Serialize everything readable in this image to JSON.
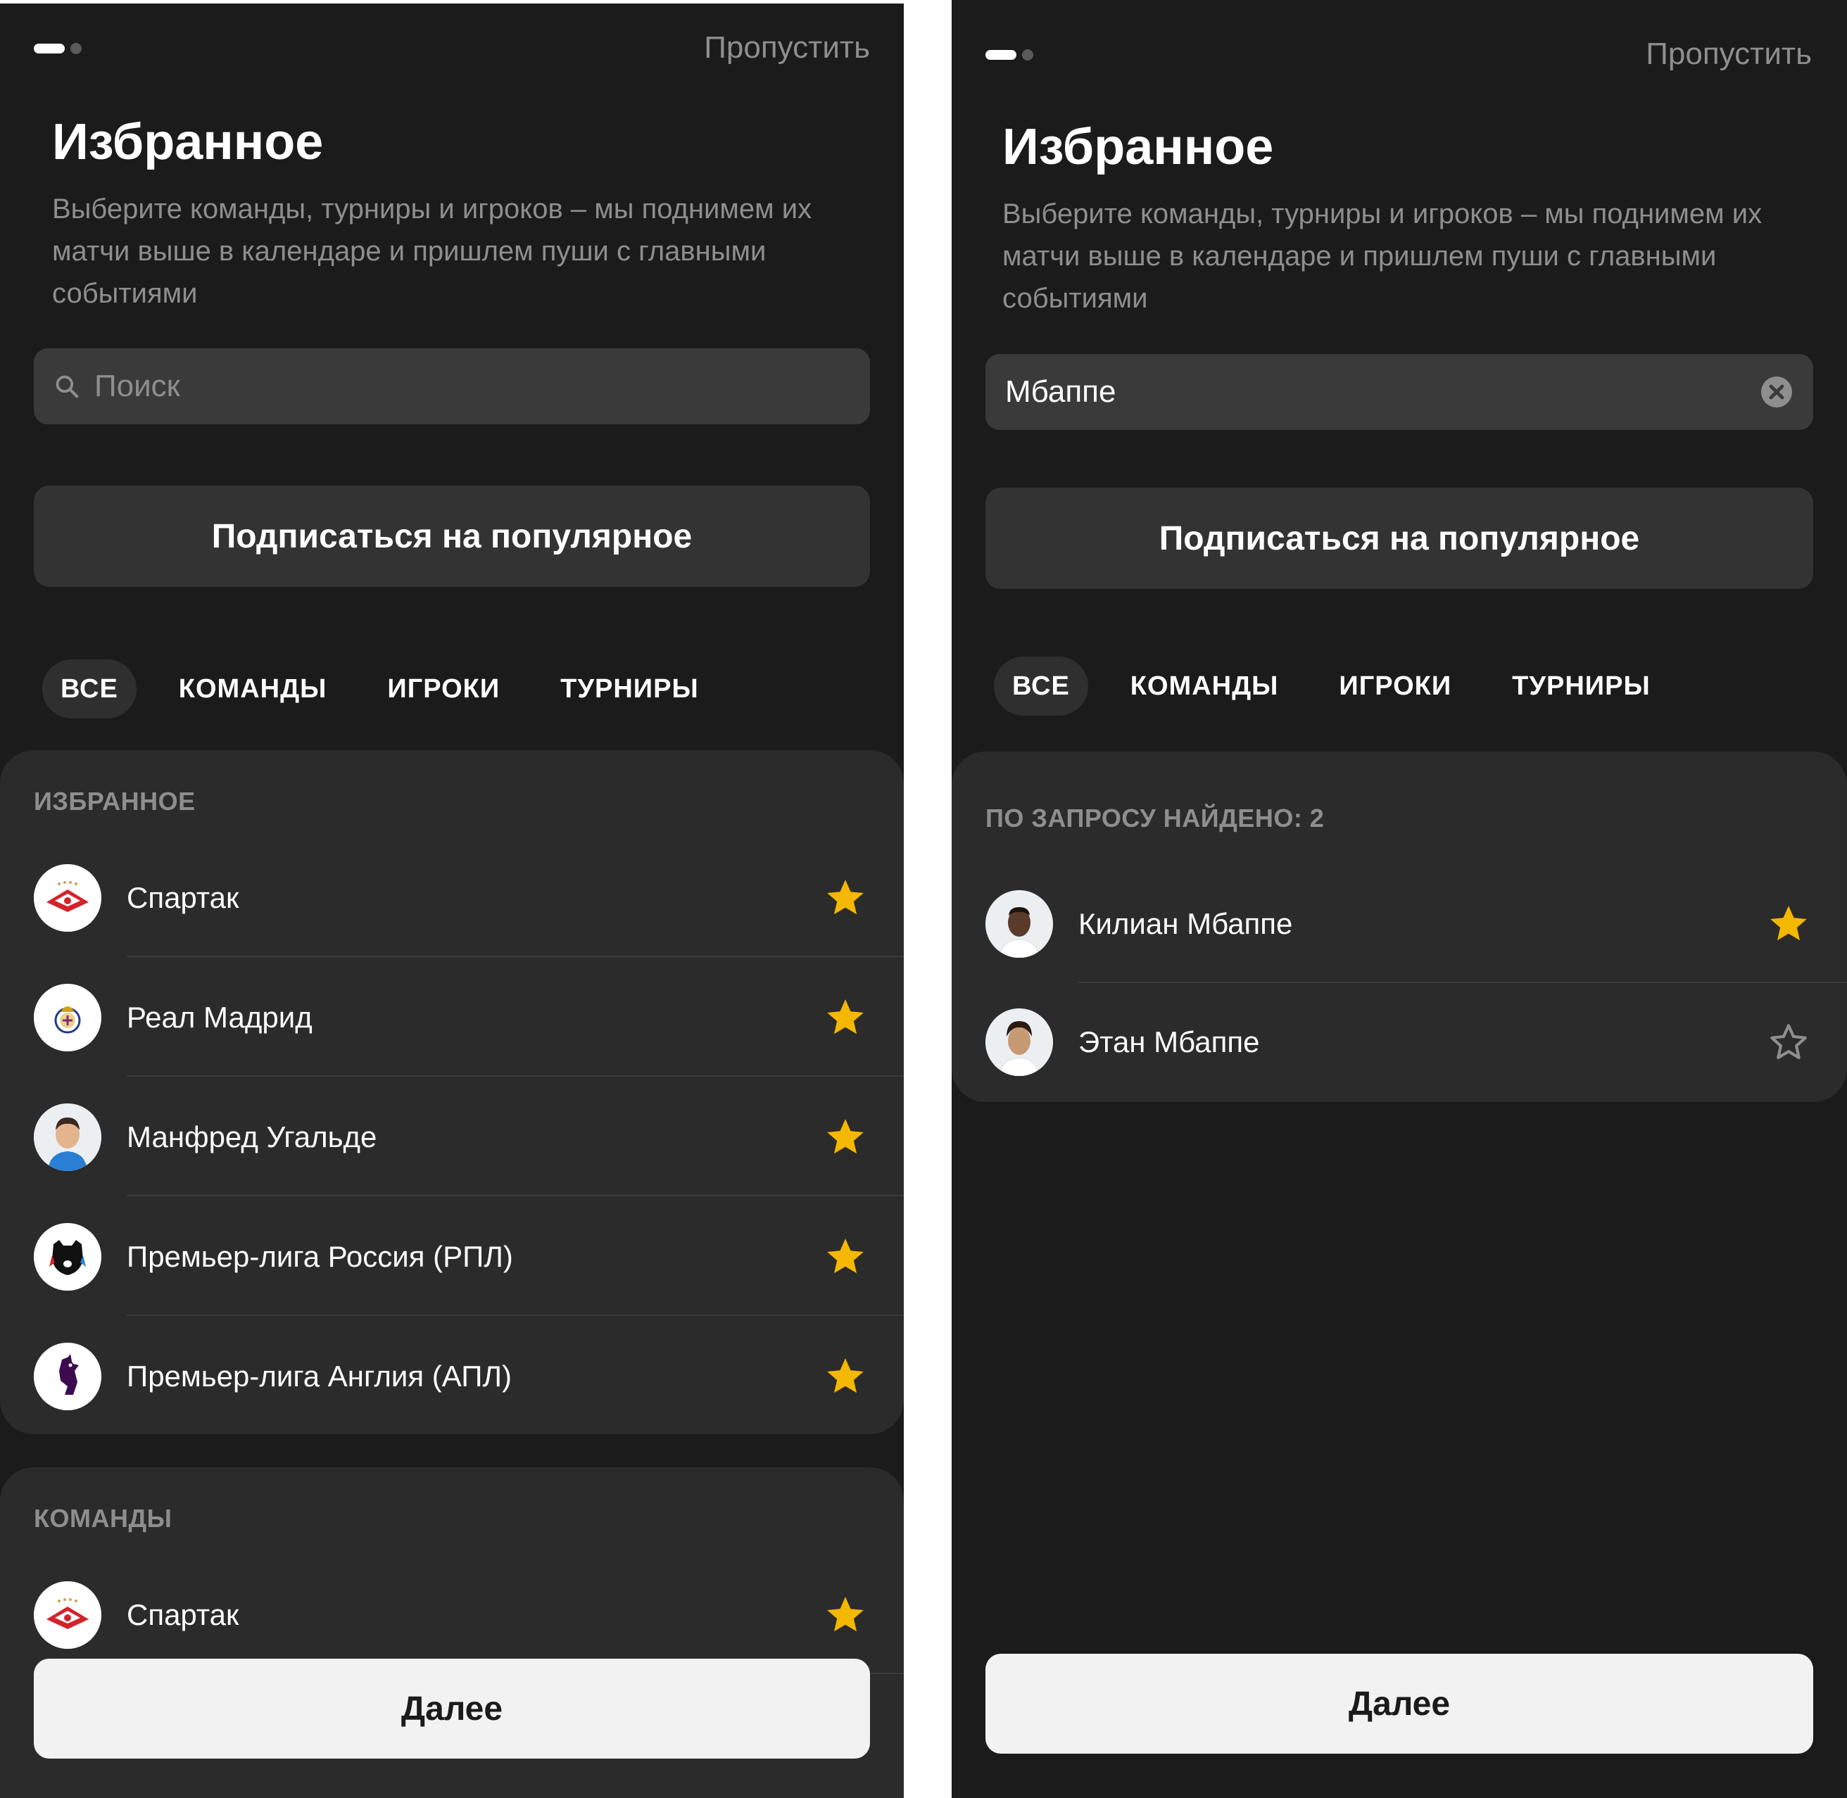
{
  "screens": [
    {
      "skip_label": "Пропустить",
      "title": "Избранное",
      "subtitle": "Выберите команды, турниры и игроков – мы поднимем их матчи выше в календаре и пришлем пуши с главными событиями",
      "search": {
        "placeholder": "Поиск",
        "value": ""
      },
      "popular_button": "Подписаться на популярное",
      "tabs": [
        {
          "label": "ВСЕ",
          "active": true
        },
        {
          "label": "КОМАНДЫ",
          "active": false
        },
        {
          "label": "ИГРОКИ",
          "active": false
        },
        {
          "label": "ТУРНИРЫ",
          "active": false
        }
      ],
      "favorites_section": {
        "label": "ИЗБРАННОЕ",
        "items": [
          {
            "name": "Спартак",
            "icon": "spartak-logo",
            "starred": true
          },
          {
            "name": "Реал Мадрид",
            "icon": "real-madrid-logo",
            "starred": true
          },
          {
            "name": "Манфред Угальде",
            "icon": "player-photo",
            "starred": true
          },
          {
            "name": "Премьер-лига Россия (РПЛ)",
            "icon": "rpl-logo",
            "starred": true
          },
          {
            "name": "Премьер-лига Англия (АПЛ)",
            "icon": "epl-logo",
            "starred": true
          }
        ]
      },
      "teams_section": {
        "label": "КОМАНДЫ",
        "items": [
          {
            "name": "Спартак",
            "icon": "spartak-logo",
            "starred": true
          }
        ]
      },
      "next_button": "Далее"
    },
    {
      "skip_label": "Пропустить",
      "title": "Избранное",
      "subtitle": "Выберите команды, турниры и игроков – мы поднимем их матчи выше в календаре и пришлем пуши с главными событиями",
      "search": {
        "placeholder": "Поиск",
        "value": "Мбаппе"
      },
      "popular_button": "Подписаться на популярное",
      "tabs": [
        {
          "label": "ВСЕ",
          "active": true
        },
        {
          "label": "КОМАНДЫ",
          "active": false
        },
        {
          "label": "ИГРОКИ",
          "active": false
        },
        {
          "label": "ТУРНИРЫ",
          "active": false
        }
      ],
      "results_section": {
        "label": "ПО ЗАПРОСУ НАЙДЕНО: 2",
        "items": [
          {
            "name": "Килиан Мбаппе",
            "icon": "player-photo",
            "starred": true
          },
          {
            "name": "Этан Мбаппе",
            "icon": "player-photo",
            "starred": false
          }
        ]
      },
      "next_button": "Далее"
    }
  ],
  "colors": {
    "background": "#1b1b1b",
    "card": "#2b2b2b",
    "star_active": "#f5b800",
    "star_inactive": "#8e8e8e",
    "muted_text": "#8e8e8e"
  }
}
